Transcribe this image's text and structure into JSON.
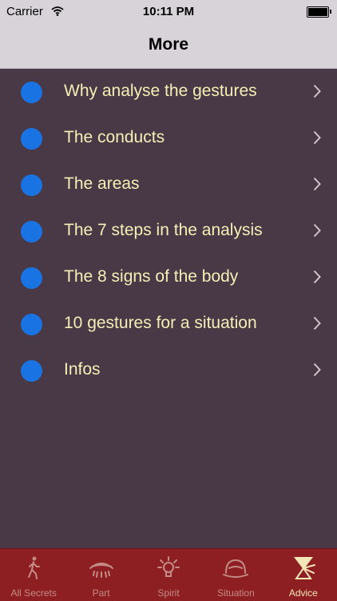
{
  "status_bar": {
    "carrier": "Carrier",
    "time": "10:11 PM"
  },
  "nav": {
    "title": "More"
  },
  "menu": {
    "items": [
      {
        "label": "Why analyse the gestures"
      },
      {
        "label": "The conducts"
      },
      {
        "label": "The areas"
      },
      {
        "label": "The 7 steps in the analysis"
      },
      {
        "label": "The 8 signs of the body"
      },
      {
        "label": "10 gestures for a situation"
      },
      {
        "label": "Infos"
      }
    ]
  },
  "tabs": {
    "items": [
      {
        "label": "All Secrets",
        "icon": "walking-person-icon"
      },
      {
        "label": "Part",
        "icon": "eye-icon"
      },
      {
        "label": "Spirit",
        "icon": "lightbulb-icon"
      },
      {
        "label": "Situation",
        "icon": "hat-icon"
      },
      {
        "label": "Advice",
        "icon": "hourglass-icon",
        "active": true
      }
    ]
  },
  "colors": {
    "background": "#493947",
    "bullet": "#1a73e3",
    "item_text": "#f4efb6",
    "tab_bar": "#8d1f22",
    "tab_inactive": "#c58b86",
    "tab_active": "#f3e7b8"
  }
}
